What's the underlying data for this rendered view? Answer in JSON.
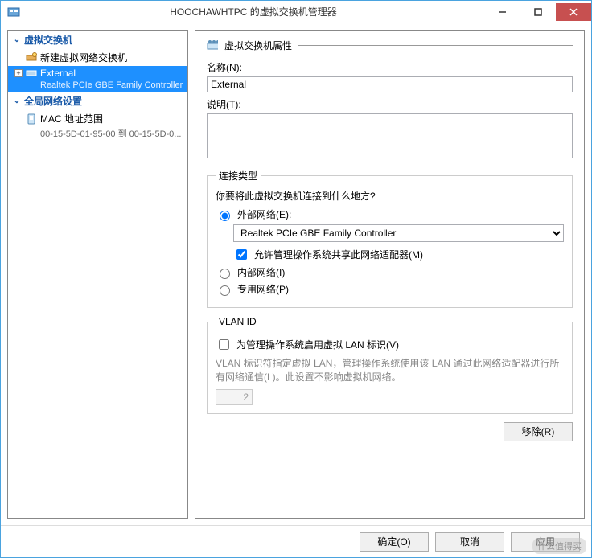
{
  "titlebar": {
    "title": "HOOCHAWHTPC 的虚拟交换机管理器"
  },
  "sidebar": {
    "switches_header": "虚拟交换机",
    "new_switch": "新建虚拟网络交换机",
    "external_name": "External",
    "external_adapter": "Realtek PCIe GBE Family Controller",
    "global_header": "全局网络设置",
    "mac_range": "MAC 地址范围",
    "mac_range_detail": "00-15-5D-01-95-00 到 00-15-5D-0..."
  },
  "props": {
    "header": "虚拟交换机属性",
    "name_label": "名称(N):",
    "name_value": "External",
    "desc_label": "说明(T):",
    "desc_value": ""
  },
  "conn": {
    "legend": "连接类型",
    "question": "你要将此虚拟交换机连接到什么地方?",
    "ext_label": "外部网络(E):",
    "adapter": "Realtek PCIe GBE Family Controller",
    "share_label": "允许管理操作系统共享此网络适配器(M)",
    "int_label": "内部网络(I)",
    "priv_label": "专用网络(P)"
  },
  "vlan": {
    "legend": "VLAN ID",
    "enable_label": "为管理操作系统启用虚拟 LAN 标识(V)",
    "note": "VLAN 标识符指定虚拟 LAN，管理操作系统使用该 LAN 通过此网络适配器进行所有网络通信(L)。此设置不影响虚拟机网络。",
    "value": "2"
  },
  "buttons": {
    "remove": "移除(R)",
    "ok": "确定(O)",
    "cancel": "取消",
    "apply": "应用"
  },
  "watermark": "什么值得买"
}
